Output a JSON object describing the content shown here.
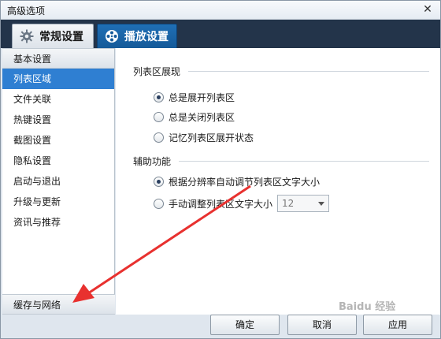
{
  "window": {
    "title": "高级选项",
    "close_glyph": "✕"
  },
  "tabs": [
    {
      "label": "常规设置",
      "icon": "gear-icon",
      "active": true
    },
    {
      "label": "播放设置",
      "icon": "film-reel-icon",
      "active": false
    }
  ],
  "sidebar": {
    "items": [
      {
        "label": "基本设置",
        "kind": "header"
      },
      {
        "label": "列表区域",
        "kind": "selected"
      },
      {
        "label": "文件关联"
      },
      {
        "label": "热键设置"
      },
      {
        "label": "截图设置"
      },
      {
        "label": "隐私设置"
      },
      {
        "label": "启动与退出"
      },
      {
        "label": "升级与更新"
      },
      {
        "label": "资讯与推荐"
      }
    ],
    "bottom_item": "缓存与网络"
  },
  "content": {
    "group1": {
      "title": "列表区展现",
      "options": [
        {
          "label": "总是展开列表区",
          "checked": true
        },
        {
          "label": "总是关闭列表区",
          "checked": false
        },
        {
          "label": "记忆列表区展开状态",
          "checked": false
        }
      ]
    },
    "group2": {
      "title": "辅助功能",
      "options": [
        {
          "label": "根据分辨率自动调节列表区文字大小",
          "checked": true
        },
        {
          "label": "手动调整列表区文字大小",
          "checked": false
        }
      ],
      "font_size_select": "12"
    }
  },
  "footer": {
    "ok": "确定",
    "cancel": "取消",
    "apply": "应用"
  },
  "colors": {
    "accent": "#2f7fd2",
    "tabbar": "#23344a",
    "arrow": "#e8312f"
  },
  "watermark": "Baidu 经验"
}
